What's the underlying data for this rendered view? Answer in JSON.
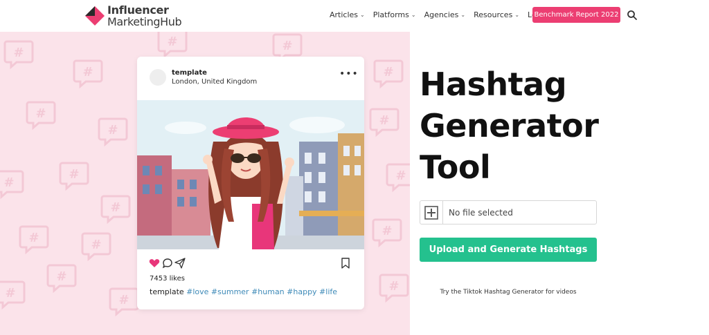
{
  "header": {
    "logo_line1": "Influencer",
    "logo_line2a": "Marketing",
    "logo_line2b": "Hub",
    "nav": [
      {
        "label": "Articles",
        "has_dropdown": true
      },
      {
        "label": "Platforms",
        "has_dropdown": true
      },
      {
        "label": "Agencies",
        "has_dropdown": true
      },
      {
        "label": "Resources",
        "has_dropdown": true
      },
      {
        "label": "Login",
        "has_dropdown": false
      }
    ],
    "cta_label": "Benchmark Report 2022",
    "search_icon": "search-icon"
  },
  "card": {
    "username": "template",
    "location": "London, United Kingdom",
    "likes": "7453 likes",
    "caption_user": "template",
    "caption_tags": "#love #summer #human #happy #life",
    "icons": [
      "heart-icon",
      "comment-icon",
      "share-icon",
      "bookmark-icon",
      "more-icon"
    ]
  },
  "hero": {
    "title_line1": "Hashtag",
    "title_line2": "Generator",
    "title_line3": "Tool",
    "file_status": "No file selected",
    "upload_label": "Upload and Generate Hashtags",
    "tiktok_text": "Try the Tiktok Hashtag Generator for videos"
  },
  "colors": {
    "brand_pink": "#ec3e72",
    "cta_green": "#24c18e",
    "hero_bg": "#fbe3ea",
    "tag_blue": "#3e8ab8"
  }
}
